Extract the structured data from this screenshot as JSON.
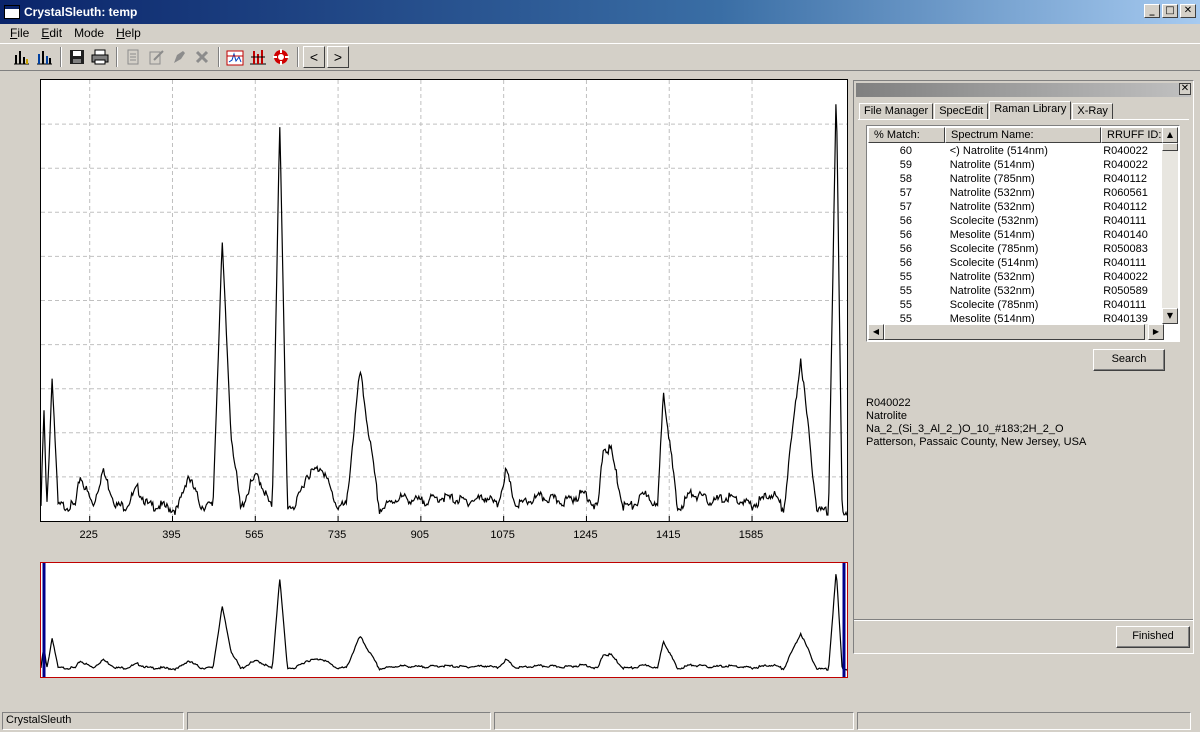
{
  "window": {
    "title": "CrystalSleuth: temp"
  },
  "menu": [
    {
      "label": "File",
      "underline": "F",
      "rest": "ile"
    },
    {
      "label": "Edit",
      "underline": "E",
      "rest": "dit"
    },
    {
      "label": "Mode",
      "underline": "",
      "rest": "Mode"
    },
    {
      "label": "Help",
      "underline": "H",
      "rest": "elp"
    }
  ],
  "toolbar": {
    "icons": [
      "histogram-icon",
      "histogram-overlay-icon",
      "save-icon",
      "print-icon",
      "document-icon",
      "edit-icon",
      "stamp-icon",
      "delete-icon",
      "spectrum-fit-icon",
      "peak-tool-icon",
      "lifebuoy-icon"
    ],
    "prev": "<",
    "next": ">"
  },
  "spectrum": {
    "x_ticks": [
      "225",
      "395",
      "565",
      "735",
      "905",
      "1075",
      "1245",
      "1415",
      "1585"
    ],
    "x_range": [
      125,
      1780
    ]
  },
  "chart_data": {
    "type": "line",
    "x_ticks": [
      225,
      395,
      565,
      735,
      905,
      1075,
      1245,
      1415,
      1585
    ],
    "xlim": [
      125,
      1780
    ],
    "ylim": [
      0,
      1
    ],
    "grid": true,
    "x": [
      125,
      131,
      137,
      148,
      160,
      196,
      205,
      232,
      252,
      280,
      300,
      323,
      345,
      371,
      405,
      427,
      454,
      478,
      497,
      515,
      535,
      556,
      570,
      600,
      615,
      631,
      648,
      670,
      702,
      732,
      752,
      780,
      820,
      860,
      905,
      950,
      1000,
      1040,
      1062,
      1080,
      1100,
      1150,
      1200,
      1243,
      1268,
      1279,
      1295,
      1320,
      1340,
      1370,
      1391,
      1403,
      1432,
      1460,
      1500,
      1540,
      1585,
      1628,
      1650,
      1685,
      1718,
      1742,
      1758,
      1770,
      1780
    ],
    "y": [
      0.03,
      0.25,
      0.02,
      0.33,
      0.03,
      0.03,
      0.1,
      0.03,
      0.11,
      0.03,
      0.03,
      0.07,
      0.03,
      0.03,
      0.02,
      0.1,
      0.03,
      0.03,
      0.63,
      0.2,
      0.02,
      0.08,
      0.1,
      0.02,
      0.92,
      0.03,
      0.03,
      0.1,
      0.12,
      0.03,
      0.03,
      0.34,
      0.02,
      0.05,
      0.04,
      0.05,
      0.04,
      0.05,
      0.03,
      0.11,
      0.03,
      0.05,
      0.04,
      0.06,
      0.02,
      0.16,
      0.16,
      0.03,
      0.03,
      0.06,
      0.02,
      0.3,
      0.02,
      0.06,
      0.04,
      0.05,
      0.03,
      0.06,
      0.02,
      0.37,
      0.02,
      0.02,
      0.99,
      0.02,
      0.02
    ]
  },
  "panel": {
    "tabs": [
      "File Manager",
      "SpecEdit",
      "Raman Library",
      "X-Ray"
    ],
    "active_tab": 2,
    "columns": [
      "% Match:",
      "Spectrum Name:",
      "RRUFF ID:"
    ],
    "rows": [
      {
        "match": "60",
        "name": "<) Natrolite  (514nm)",
        "id": "R040022"
      },
      {
        "match": "59",
        "name": "Natrolite  (514nm)",
        "id": "R040022"
      },
      {
        "match": "58",
        "name": "Natrolite  (785nm)",
        "id": "R040112"
      },
      {
        "match": "57",
        "name": "Natrolite  (532nm)",
        "id": "R060561"
      },
      {
        "match": "57",
        "name": "Natrolite  (532nm)",
        "id": "R040112"
      },
      {
        "match": "56",
        "name": "Scolecite  (532nm)",
        "id": "R040111"
      },
      {
        "match": "56",
        "name": "Mesolite  (514nm)",
        "id": "R040140"
      },
      {
        "match": "56",
        "name": "Scolecite  (785nm)",
        "id": "R050083"
      },
      {
        "match": "56",
        "name": "Scolecite  (514nm)",
        "id": "R040111"
      },
      {
        "match": "55",
        "name": "Natrolite  (532nm)",
        "id": "R040022"
      },
      {
        "match": "55",
        "name": "Natrolite  (532nm)",
        "id": "R050589"
      },
      {
        "match": "55",
        "name": "Scolecite  (785nm)",
        "id": "R040111"
      },
      {
        "match": "55",
        "name": "Mesolite  (514nm)",
        "id": "R040139"
      }
    ],
    "search_label": "Search",
    "info": {
      "id": "R040022",
      "mineral": "Natrolite",
      "formula": "Na_2_(Si_3_Al_2_)O_10_#183;2H_2_O",
      "locality": "Patterson, Passaic County, New Jersey, USA"
    },
    "finished_label": "Finished"
  },
  "status": {
    "text": "CrystalSleuth"
  },
  "colors": {
    "curve": "#000000",
    "frame": "#c00000",
    "marker": "#00008b",
    "grid": "#c0c0c0"
  }
}
